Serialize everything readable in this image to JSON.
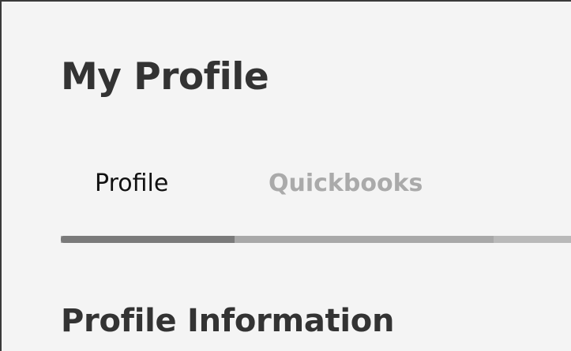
{
  "page": {
    "title": "My Profile"
  },
  "tabs": [
    {
      "label": "Profile",
      "active": true
    },
    {
      "label": "Quickbooks",
      "active": false
    }
  ],
  "section": {
    "title": "Profile Information"
  },
  "colors": {
    "background": "#f4f4f4",
    "title_text": "#333333",
    "active_tab_text": "#111111",
    "inactive_tab_text": "#aaaaaa",
    "tab_track": "#a8a8a8",
    "tab_indicator": "#7a7a7a"
  }
}
